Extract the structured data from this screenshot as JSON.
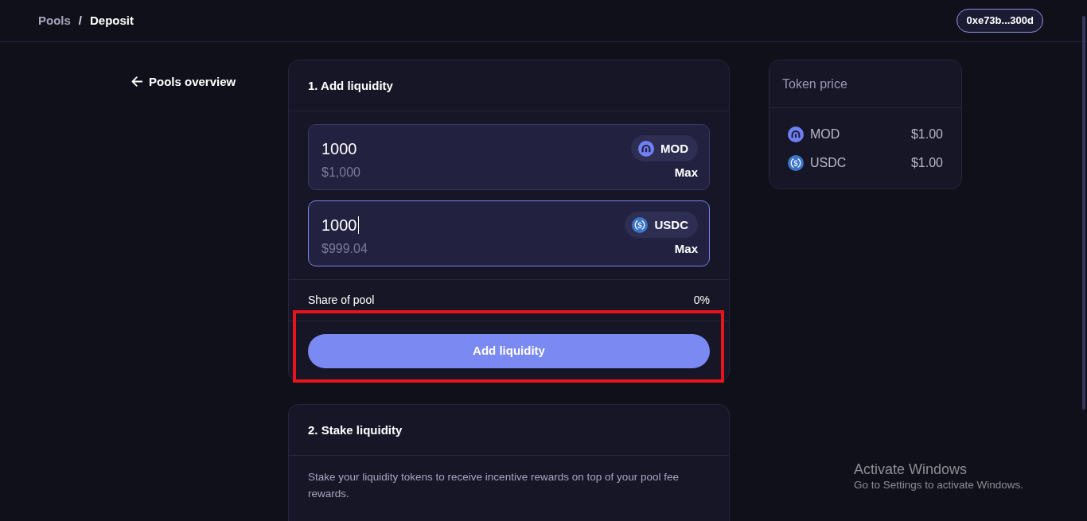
{
  "header": {
    "breadcrumb": [
      {
        "label": "Pools",
        "current": false
      },
      {
        "label": "Deposit",
        "current": true
      }
    ],
    "separator": "/",
    "wallet": {
      "label": "0xe73b...300d"
    }
  },
  "back_link": {
    "label": "Pools overview"
  },
  "add_liquidity": {
    "title": "1. Add liquidity",
    "inputs": [
      {
        "kind": "arch",
        "value": "1000",
        "usd_value": "$1,000",
        "token": "MOD",
        "max_label": "Max",
        "focused": false
      },
      {
        "kind": "dollar",
        "value": "1000",
        "usd_value": "$999.04",
        "token": "USDC",
        "max_label": "Max",
        "focused": true
      }
    ],
    "share": {
      "label": "Share of pool",
      "value": "0%"
    },
    "button": {
      "label": "Add liquidity"
    }
  },
  "stake_liquidity": {
    "title": "2. Stake liquidity",
    "description": "Stake your liquidity tokens to receive incentive rewards on top of your pool fee rewards."
  },
  "token_price": {
    "title": "Token price",
    "rows": [
      {
        "kind": "arch",
        "symbol": "MOD",
        "price": "$1.00"
      },
      {
        "kind": "dollar",
        "symbol": "USDC",
        "price": "$1.00"
      }
    ]
  },
  "annotation": {
    "kind": "frame"
  },
  "os_notice": {
    "title": "Activate Windows",
    "message": "Go to Settings to activate Windows."
  }
}
